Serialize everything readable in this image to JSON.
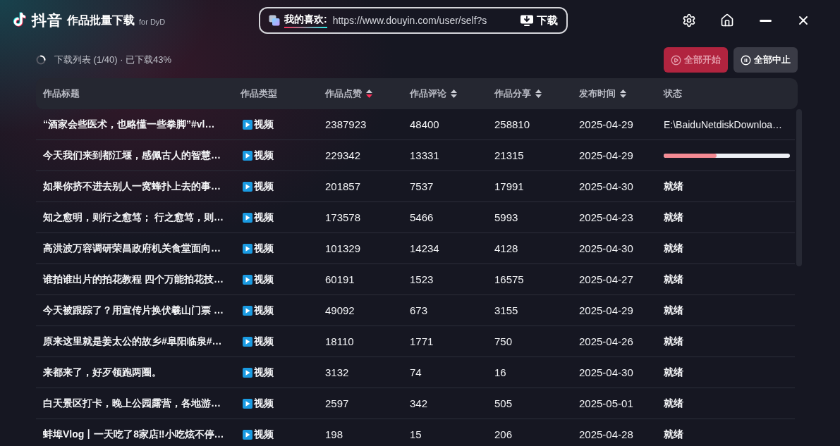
{
  "app": {
    "title": "抖音",
    "subtitle": "作品批量下载",
    "tag": "for DyD"
  },
  "source_bar": {
    "label": "我的喜欢:",
    "url": "https://www.douyin.com/user/self?s",
    "button": "下载"
  },
  "toolbar": {
    "summary": "下载列表 (1/40) · 已下载43%",
    "buttons": [
      {
        "label": "全部开始",
        "kind": "start",
        "disabled": true
      },
      {
        "label": "全部中止",
        "kind": "stop",
        "disabled": false
      }
    ]
  },
  "table": {
    "columns": [
      {
        "label": "作品标题",
        "sortable": false
      },
      {
        "label": "作品类型",
        "sortable": false
      },
      {
        "label": "作品点赞",
        "sortable": true,
        "sorted": true
      },
      {
        "label": "作品评论",
        "sortable": true,
        "sorted": false
      },
      {
        "label": "作品分享",
        "sortable": true,
        "sorted": false
      },
      {
        "label": "发布时间",
        "sortable": true,
        "sorted": false
      },
      {
        "label": "状态",
        "sortable": false
      }
    ],
    "rows": [
      {
        "title": "“酒家会些医术，也略懂一些拳脚”#vl…",
        "type": "视频",
        "likes": "2387923",
        "comments": "48400",
        "shares": "258810",
        "date": "2025-04-29",
        "status": {
          "kind": "path",
          "text": "E:\\BaiduNetdiskDownloa…"
        }
      },
      {
        "title": "今天我们来到都江堰，感佩古人的智慧…",
        "type": "视频",
        "likes": "229342",
        "comments": "13331",
        "shares": "21315",
        "date": "2025-04-29",
        "status": {
          "kind": "progress",
          "level": 0.42
        }
      },
      {
        "title": "如果你挤不进去别人一窝蜂扑上去的事…",
        "type": "视频",
        "likes": "201857",
        "comments": "7537",
        "shares": "17991",
        "date": "2025-04-30",
        "status": {
          "kind": "text",
          "text": "就绪"
        }
      },
      {
        "title": "知之愈明，则行之愈笃； 行之愈笃，则…",
        "type": "视频",
        "likes": "173578",
        "comments": "5466",
        "shares": "5993",
        "date": "2025-04-23",
        "status": {
          "kind": "text",
          "text": "就绪"
        }
      },
      {
        "title": "高洪波万容调研荣昌政府机关食堂面向…",
        "type": "视频",
        "likes": "101329",
        "comments": "14234",
        "shares": "4128",
        "date": "2025-04-30",
        "status": {
          "kind": "text",
          "text": "就绪"
        }
      },
      {
        "title": "谁拍谁出片的拍花教程 四个万能拍花技…",
        "type": "视频",
        "likes": "60191",
        "comments": "1523",
        "shares": "16575",
        "date": "2025-04-27",
        "status": {
          "kind": "text",
          "text": "就绪"
        }
      },
      {
        "title": "今天被跟踪了？用宣传片换伏羲山门票 …",
        "type": "视频",
        "likes": "49092",
        "comments": "673",
        "shares": "3155",
        "date": "2025-04-29",
        "status": {
          "kind": "text",
          "text": "就绪"
        }
      },
      {
        "title": "原来这里就是姜太公的故乡#阜阳临泉#…",
        "type": "视频",
        "likes": "18110",
        "comments": "1771",
        "shares": "750",
        "date": "2025-04-26",
        "status": {
          "kind": "text",
          "text": "就绪"
        }
      },
      {
        "title": "来都来了，好歹领跑两圈。",
        "type": "视频",
        "likes": "3132",
        "comments": "74",
        "shares": "16",
        "date": "2025-04-30",
        "status": {
          "kind": "text",
          "text": "就绪"
        }
      },
      {
        "title": "白天景区打卡，晚上公园露营，各地游…",
        "type": "视频",
        "likes": "2597",
        "comments": "342",
        "shares": "505",
        "date": "2025-05-01",
        "status": {
          "kind": "text",
          "text": "就绪"
        }
      },
      {
        "title": "蚌埠Vlog丨一天吃了8家店‼小吃炫不停…",
        "type": "视频",
        "likes": "198",
        "comments": "15",
        "shares": "206",
        "date": "2025-04-28",
        "status": {
          "kind": "text",
          "text": "就绪"
        }
      }
    ]
  }
}
